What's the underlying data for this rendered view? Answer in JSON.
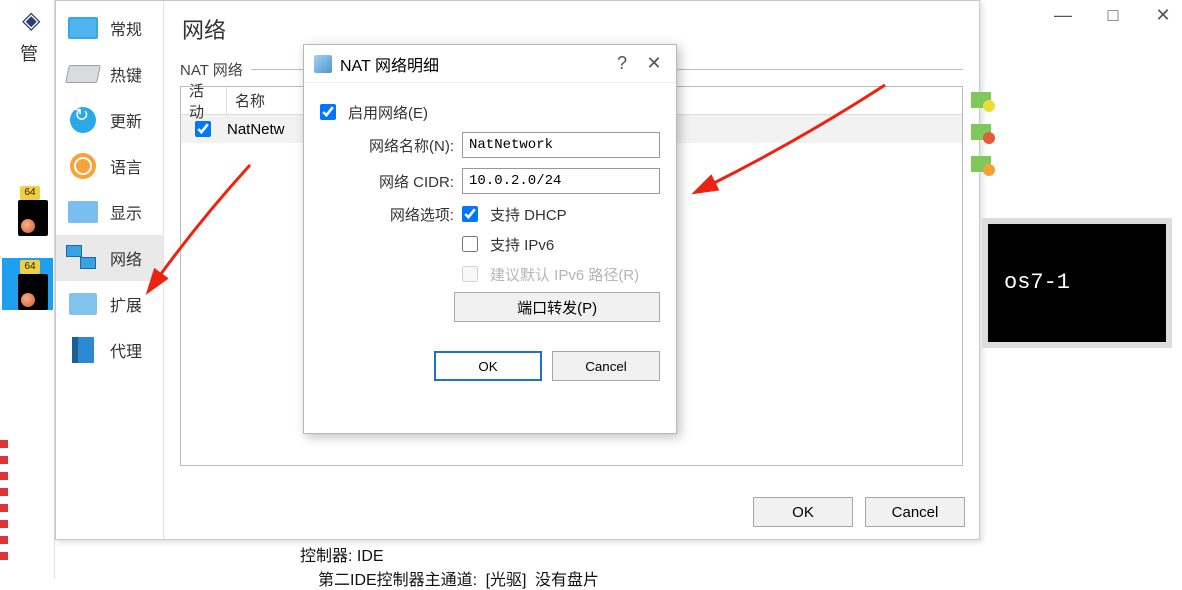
{
  "leftcol": {
    "manager_label": "管",
    "badge_64": "64"
  },
  "winctrl": {
    "min": "—",
    "max": "□",
    "close": "✕"
  },
  "settings": {
    "section_title": "网络",
    "side_items": [
      {
        "label": "常规"
      },
      {
        "label": "热键"
      },
      {
        "label": "更新"
      },
      {
        "label": "语言"
      },
      {
        "label": "显示"
      },
      {
        "label": "网络"
      },
      {
        "label": "扩展"
      },
      {
        "label": "代理"
      }
    ],
    "fieldset_label": "NAT 网络",
    "list": {
      "col_active": "活动",
      "col_name": "名称",
      "rows": [
        {
          "active": true,
          "name": "NatNetw"
        }
      ]
    },
    "ok_label": "OK",
    "cancel_label": "Cancel"
  },
  "natdlg": {
    "title": "NAT 网络明细",
    "help": "?",
    "close": "✕",
    "enable_label": "启用网络(E)",
    "enable_checked": true,
    "name_label": "网络名称(N):",
    "name_value": "NatNetwork",
    "cidr_label": "网络 CIDR:",
    "cidr_value": "10.0.2.0/24",
    "opts_label": "网络选项:",
    "dhcp_label": "支持 DHCP",
    "dhcp_checked": true,
    "ipv6_label": "支持 IPv6",
    "ipv6_checked": false,
    "ipv6_route_label": "建议默认 IPv6 路径(R)",
    "portfwd_label": "端口转发(P)",
    "ok_label": "OK",
    "cancel_label": "Cancel"
  },
  "vmprev": {
    "name": "os7-1"
  },
  "bottom": {
    "line1": "控制器: IDE",
    "line2_pre": "第二IDE控制器主通道:",
    "line2_mid": "[光驱]",
    "line2_post": "没有盘片"
  }
}
